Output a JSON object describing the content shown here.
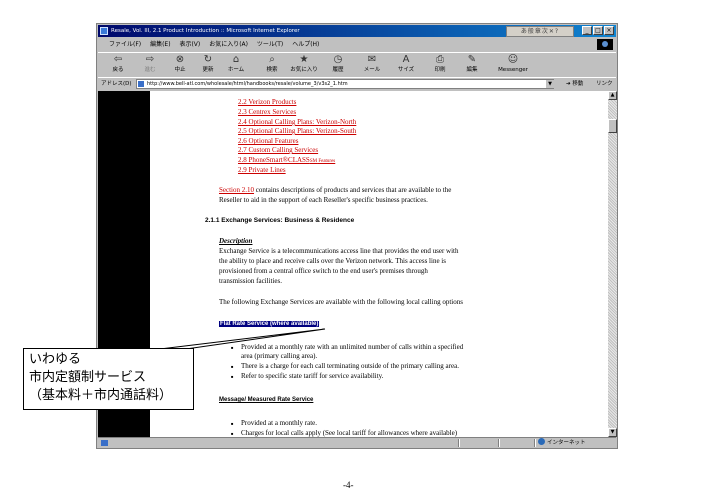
{
  "window": {
    "title": "Resale, Vol. III, 2.1 Product Introduction :: Microsoft Internet Explorer",
    "ime_bar": "あ般章次✕?",
    "controls": {
      "minimize": "_",
      "maximize": "□",
      "close": "×"
    }
  },
  "menu": [
    "ファイル(F)",
    "編集(E)",
    "表示(V)",
    "お気に入り(A)",
    "ツール(T)",
    "ヘルプ(H)"
  ],
  "toolbar": [
    {
      "label": "戻る",
      "icon": "back-arrow-icon",
      "glyph": "⇦"
    },
    {
      "label": "進む",
      "icon": "forward-arrow-icon",
      "glyph": "⇨"
    },
    {
      "label": "中止",
      "icon": "stop-icon",
      "glyph": "⊗"
    },
    {
      "label": "更新",
      "icon": "refresh-icon",
      "glyph": "↻"
    },
    {
      "label": "ホーム",
      "icon": "home-icon",
      "glyph": "⌂"
    },
    {
      "label": "検索",
      "icon": "search-icon",
      "glyph": "⌕"
    },
    {
      "label": "お気に入り",
      "icon": "favorites-icon",
      "glyph": "★"
    },
    {
      "label": "履歴",
      "icon": "history-icon",
      "glyph": "◷"
    },
    {
      "label": "メール",
      "icon": "mail-icon",
      "glyph": "✉"
    },
    {
      "label": "サイズ",
      "icon": "font-size-icon",
      "glyph": "A"
    },
    {
      "label": "印刷",
      "icon": "print-icon",
      "glyph": "⎙"
    },
    {
      "label": "編集",
      "icon": "edit-icon",
      "glyph": "✎"
    },
    {
      "label": "Messenger",
      "icon": "messenger-icon",
      "glyph": "☺"
    }
  ],
  "address": {
    "label": "アドレス(D)",
    "url": "http://www.bell-atl.com/wholesale/html/handbooks/resale/volume_3/v3s2_1.htm",
    "go_label": "移動",
    "links_label": "リンク"
  },
  "page": {
    "toc_links": [
      "2.2 Verizon Products",
      "2.3 Centrex Services",
      "2.4 Optional Calling Plans: Verizon-North",
      "2.5 Optional Calling Plans: Verizon-South",
      "2.6 Optional Features",
      "2.7 Custom Calling Services",
      "2.8 PhoneSmart®CLASS"
    ],
    "toc_sm": "SM",
    "toc_features": " Features",
    "toc_last": "2.9 Private Lines",
    "section_link": "Section 2.10",
    "section_text_1": " contains descriptions of products and services that are available to the",
    "section_text_2": "Reseller to aid in the support of each Reseller's specific business practices.",
    "heading": "2.1.1 Exchange Services: Business & Residence",
    "description_label": "Description",
    "description": [
      "Exchange Service is a telecommunications access line that provides the end user with",
      "the ability to place and receive calls over the Verizon network. This access line is",
      "provisioned from a central office switch to the end user's premises through",
      "transmission facilities."
    ],
    "following": "The following Exchange Services are available with the following local calling options",
    "flat_rate": "Flat Rate Service (where available)",
    "flat_bullets": [
      "Provided at a monthly rate with an unlimited number of calls within a specified",
      "area (primary calling area).",
      "There is a charge for each call terminating outside of the primary calling area.",
      "Refer to specific state tariff for service availability."
    ],
    "measured": "Message/ Measured Rate Service",
    "measured_bullets": [
      "Provided at a monthly rate.",
      "Charges for local calls apply (See local tariff for allowances where available)"
    ]
  },
  "status": {
    "zone": "インターネット"
  },
  "callout": {
    "lines": [
      "いわゆる",
      "市内定額制サービス",
      "（基本料＋市内通話料）"
    ]
  },
  "page_number": "-4-"
}
